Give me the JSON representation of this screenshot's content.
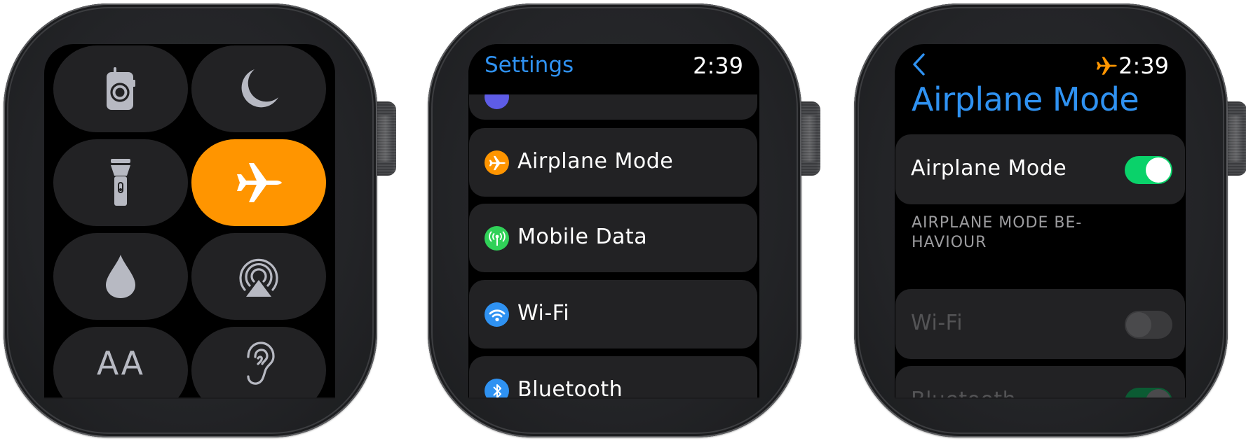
{
  "colors": {
    "accent_blue": "#2f92f2",
    "airplane_orange": "#ff9500",
    "toggle_green": "#0ad26a",
    "tile_background": "#222224"
  },
  "watch1": {
    "screen": "Control Centre",
    "tiles": [
      {
        "name": "walkie-talkie",
        "icon": "walkie-talkie-icon",
        "active": false
      },
      {
        "name": "do-not-disturb",
        "icon": "moon-icon",
        "active": false
      },
      {
        "name": "flashlight",
        "icon": "flashlight-icon",
        "active": false
      },
      {
        "name": "airplane-mode",
        "icon": "airplane-icon",
        "active": true
      },
      {
        "name": "water-lock",
        "icon": "water-drop-icon",
        "active": false
      },
      {
        "name": "airplay",
        "icon": "airplay-audio-icon",
        "active": false
      },
      {
        "name": "text-size",
        "icon": "text-size-icon",
        "active": false
      },
      {
        "name": "hearing",
        "icon": "ear-icon",
        "active": false
      }
    ],
    "text_size_glyph": "AA"
  },
  "watch2": {
    "nav_title": "Settings",
    "time": "2:39",
    "rows": [
      {
        "label": "",
        "icon": "partially-hidden-icon",
        "icon_color": "#5e5ce6"
      },
      {
        "label": "Airplane Mode",
        "icon": "airplane-icon",
        "icon_color": "#ff9500"
      },
      {
        "label": "Mobile Data",
        "icon": "antenna-icon",
        "icon_color": "#30d158"
      },
      {
        "label": "Wi-Fi",
        "icon": "wifi-icon",
        "icon_color": "#2f92f2"
      },
      {
        "label": "Bluetooth",
        "icon": "bluetooth-icon",
        "icon_color": "#2f92f2"
      }
    ]
  },
  "watch3": {
    "back_label": "<",
    "time": "2:39",
    "title": "Airplane Mode",
    "main_toggle": {
      "label": "Airplane Mode",
      "on": true
    },
    "section_header": "AIRPLANE MODE BE-\nHAVIOUR",
    "section_header_line1": "AIRPLANE MODE BE-",
    "section_header_line2": "HAVIOUR",
    "behaviour_toggles": [
      {
        "label": "Wi-Fi",
        "on": false,
        "disabled": true
      },
      {
        "label": "Bluetooth",
        "on": true,
        "disabled": true
      }
    ]
  }
}
